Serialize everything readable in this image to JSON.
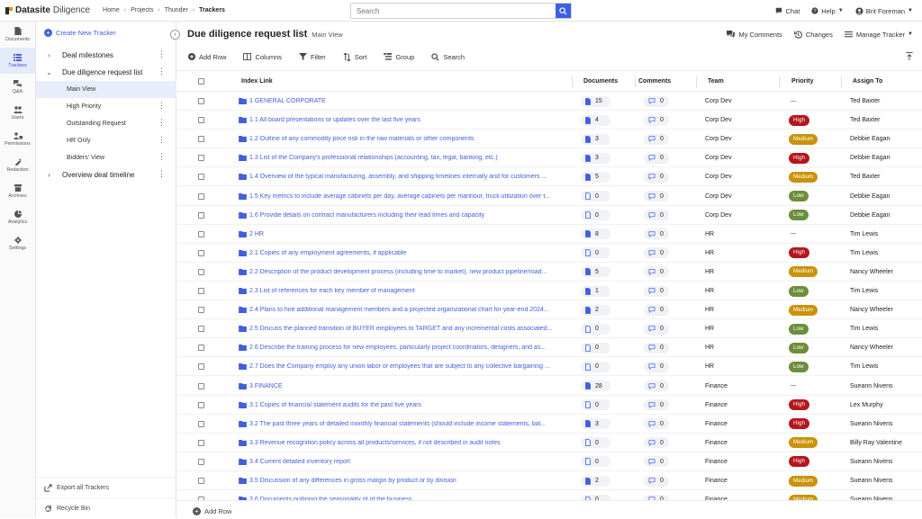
{
  "app": {
    "brand": "Datasite",
    "product": "Diligence"
  },
  "breadcrumb": [
    "Home",
    "Projects",
    "Thunder",
    "Trackers"
  ],
  "search": {
    "placeholder": "Search"
  },
  "topbar": {
    "chat": "Chat",
    "help": "Help",
    "user": "Brit Foreman"
  },
  "rail": [
    {
      "label": "Documents",
      "icon": "document-icon"
    },
    {
      "label": "Trackers",
      "icon": "list-icon",
      "active": true
    },
    {
      "label": "Q&A",
      "icon": "chat-bubbles-icon"
    },
    {
      "label": "Users",
      "icon": "users-icon"
    },
    {
      "label": "Permissions",
      "icon": "permissions-icon"
    },
    {
      "label": "Redaction",
      "icon": "redaction-icon"
    },
    {
      "label": "Archives",
      "icon": "archive-icon"
    },
    {
      "label": "Analytics",
      "icon": "pie-chart-icon"
    },
    {
      "label": "Settings",
      "icon": "gear-icon"
    }
  ],
  "sidebar": {
    "create_label": "Create New Tracker",
    "items": [
      {
        "label": "Deal milestones",
        "level": 0,
        "chev": "›"
      },
      {
        "label": "Due diligence request list",
        "level": 0,
        "chev": "⌄"
      },
      {
        "label": "Main View",
        "level": 1,
        "active": true
      },
      {
        "label": "High Priority",
        "level": 1
      },
      {
        "label": "Outstanding Request",
        "level": 1
      },
      {
        "label": "HR Only",
        "level": 1
      },
      {
        "label": "Bidders' View",
        "level": 1
      },
      {
        "label": "Overview deal timeline",
        "level": 0,
        "chev": "›"
      }
    ],
    "export_label": "Export all Trackers",
    "recycle_label": "Recycle Bin"
  },
  "header": {
    "title": "Due diligence request list",
    "view": "Main View",
    "my_comments": "My Comments",
    "changes": "Changes",
    "manage": "Manage Tracker"
  },
  "toolbar": {
    "add_row": "Add Row",
    "columns": "Columns",
    "filter": "Filter",
    "sort": "Sort",
    "group": "Group",
    "search": "Search"
  },
  "columns": {
    "index": "Index Link",
    "documents": "Documents",
    "comments": "Comments",
    "team": "Team",
    "priority": "Priority",
    "assign": "Assign To"
  },
  "priority_colors": {
    "High": "#b3161b",
    "Medium": "#c9930a",
    "Low": "#6b8e3a"
  },
  "rows": [
    {
      "index": "1 GENERAL CORPORATE",
      "docs": "15",
      "docs_filled": true,
      "comments": "0",
      "team": "Corp Dev",
      "priority": "—",
      "assign": "Ted Baxter"
    },
    {
      "index": "1.1 All board presentations or updates over the last five years",
      "docs": "4",
      "docs_filled": true,
      "comments": "0",
      "team": "Corp Dev",
      "priority": "High",
      "assign": "Ted Baxter"
    },
    {
      "index": "1.2 Outline of any commodity price risk in the raw materials or other components",
      "docs": "3",
      "docs_filled": true,
      "comments": "0",
      "team": "Corp Dev",
      "priority": "Medium",
      "assign": "Debbie Eagan"
    },
    {
      "index": "1.3 List of the Company's professional relationships (accounting, tax, legal, banking, etc.)",
      "docs": "3",
      "docs_filled": true,
      "comments": "0",
      "team": "Corp Dev",
      "priority": "High",
      "assign": "Debbie Eagan"
    },
    {
      "index": "1.4 Overview of the typical manufacturing, assembly, and shipping timelines internally and for customers ...",
      "docs": "5",
      "docs_filled": true,
      "comments": "0",
      "team": "Corp Dev",
      "priority": "Medium",
      "assign": "Ted Baxter"
    },
    {
      "index": "1.5 Key metrics to include average cabinets per day, average cabinets per manhour, truck utilization over t...",
      "docs": "0",
      "docs_filled": false,
      "comments": "0",
      "team": "Corp Dev",
      "priority": "Low",
      "assign": "Debbie Eagan"
    },
    {
      "index": "1.6 Provide details on contract manufacturers including their lead times and capacity",
      "docs": "0",
      "docs_filled": false,
      "comments": "0",
      "team": "Corp Dev",
      "priority": "Low",
      "assign": "Debbie Eagan"
    },
    {
      "index": "2 HR",
      "docs": "8",
      "docs_filled": true,
      "comments": "0",
      "team": "HR",
      "priority": "—",
      "assign": "Tim Lewis"
    },
    {
      "index": "2.1 Copies of any employment agreements, if applicable",
      "docs": "0",
      "docs_filled": false,
      "comments": "0",
      "team": "HR",
      "priority": "High",
      "assign": "Tim Lewis"
    },
    {
      "index": "2.2 Description of the product development process (including time to market), new product pipeline/road...",
      "docs": "5",
      "docs_filled": true,
      "comments": "0",
      "team": "HR",
      "priority": "Medium",
      "assign": "Nancy Wheeler"
    },
    {
      "index": "2.3 List of references for each key member of management",
      "docs": "1",
      "docs_filled": true,
      "comments": "0",
      "team": "HR",
      "priority": "Low",
      "assign": "Tim Lewis"
    },
    {
      "index": "2.4 Plans to hire additional management members and a projected organizational chart for year-end 2024...",
      "docs": "2",
      "docs_filled": true,
      "comments": "0",
      "team": "HR",
      "priority": "Medium",
      "assign": "Nancy Wheeler"
    },
    {
      "index": "2.5 Discuss the planned transition of BUYER employees to TARGET and any incremental costs associated...",
      "docs": "0",
      "docs_filled": false,
      "comments": "0",
      "team": "HR",
      "priority": "Low",
      "assign": "Tim Lewis"
    },
    {
      "index": "2.6 Describe the training process for new employees, particularly project coordinators, designers, and as...",
      "docs": "0",
      "docs_filled": false,
      "comments": "0",
      "team": "HR",
      "priority": "Low",
      "assign": "Nancy Wheeler"
    },
    {
      "index": "2.7 Does the Company employ any union labor or employees that are subject to any collective bargaining ...",
      "docs": "0",
      "docs_filled": false,
      "comments": "0",
      "team": "HR",
      "priority": "Low",
      "assign": "Tim Lewis"
    },
    {
      "index": "3 FINANCE",
      "docs": "28",
      "docs_filled": true,
      "comments": "0",
      "team": "Finance",
      "priority": "—",
      "assign": "Sueann Nivens"
    },
    {
      "index": "3.1 Copies of financial statement audits for the past five years",
      "docs": "0",
      "docs_filled": false,
      "comments": "0",
      "team": "Finance",
      "priority": "High",
      "assign": "Lex Murphy"
    },
    {
      "index": "3.2 The past three years of detailed monthly financial statements (should include income statements, bal...",
      "docs": "3",
      "docs_filled": true,
      "comments": "0",
      "team": "Finance",
      "priority": "High",
      "assign": "Sueann Nivens"
    },
    {
      "index": "3.3 Revenue recognition policy across all products/services, if not described in audit notes",
      "docs": "0",
      "docs_filled": false,
      "comments": "0",
      "team": "Finance",
      "priority": "Medium",
      "assign": "Billy Ray Valentine"
    },
    {
      "index": "3.4 Current detailed inventory report",
      "docs": "0",
      "docs_filled": false,
      "comments": "0",
      "team": "Finance",
      "priority": "High",
      "assign": "Sueann Nivens"
    },
    {
      "index": "3.5 Discussion of any differences in gross margin by product or by division",
      "docs": "2",
      "docs_filled": true,
      "comments": "0",
      "team": "Finance",
      "priority": "Medium",
      "assign": "Sueann Nivens"
    },
    {
      "index": "3.6 Documents outlining the seasonality of of the business",
      "docs": "0",
      "docs_filled": false,
      "comments": "0",
      "team": "Finance",
      "priority": "Medium",
      "assign": "Sueann Nivens"
    }
  ],
  "footer": {
    "add_row": "Add Row"
  }
}
